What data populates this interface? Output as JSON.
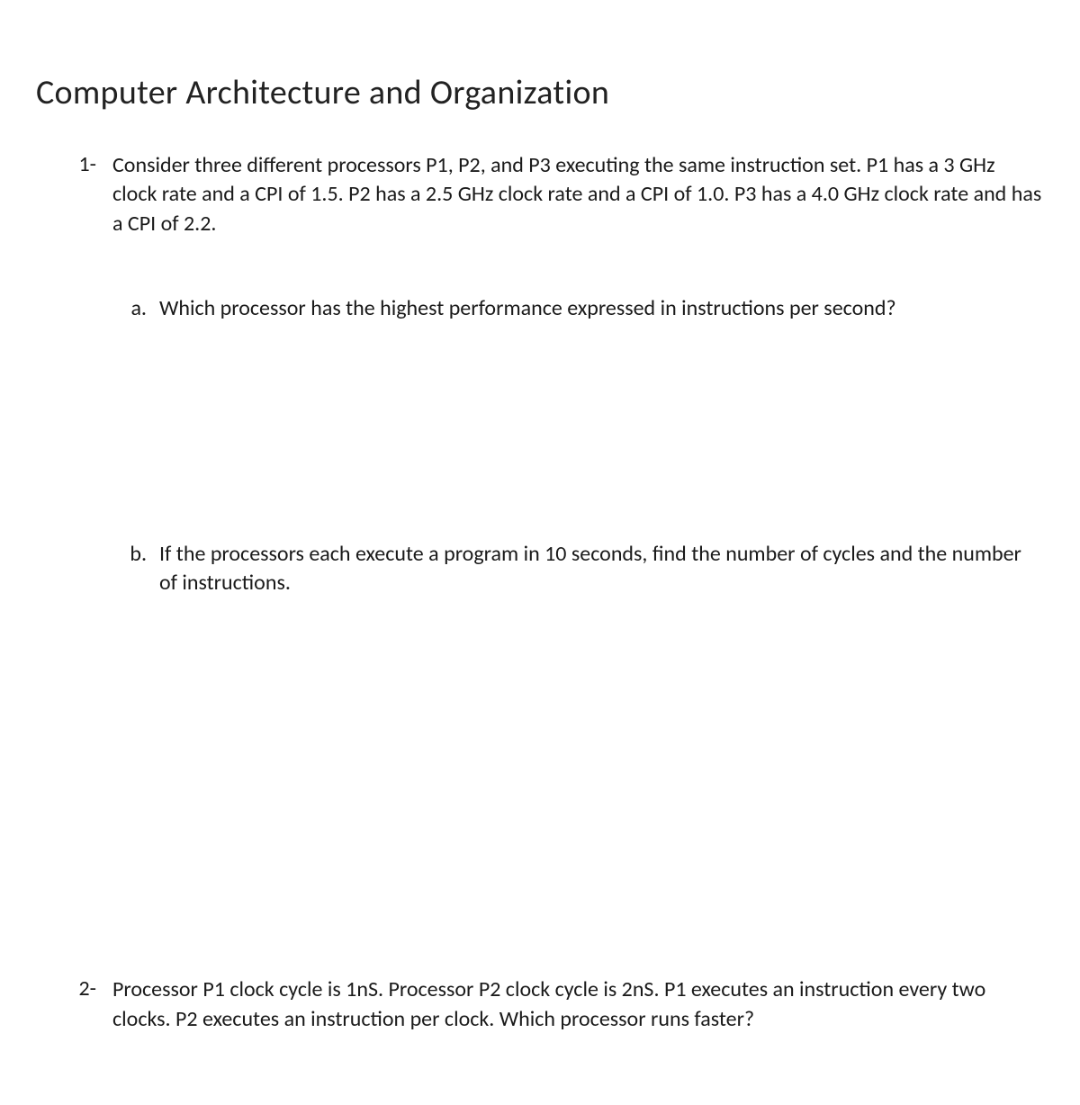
{
  "title": "Computer Architecture and Organization",
  "questions": [
    {
      "number": "1-",
      "text": "Consider three different processors P1, P2, and P3 executing the same instruction set. P1 has a 3 GHz clock rate and a CPI of 1.5. P2 has a 2.5 GHz clock rate and a CPI of 1.0. P3 has a 4.0 GHz clock rate and has a CPI of 2.2.",
      "subparts": [
        {
          "letter": "a.",
          "text": "Which processor has the highest performance expressed in instructions per second?"
        },
        {
          "letter": "b.",
          "text": "If the processors each execute a program in 10 seconds, find the number of cycles and the number of instructions."
        }
      ]
    },
    {
      "number": "2-",
      "text": "Processor P1 clock cycle is 1nS. Processor P2 clock cycle is 2nS. P1 executes an instruction every two clocks. P2 executes an instruction per clock. Which processor runs faster?"
    }
  ]
}
